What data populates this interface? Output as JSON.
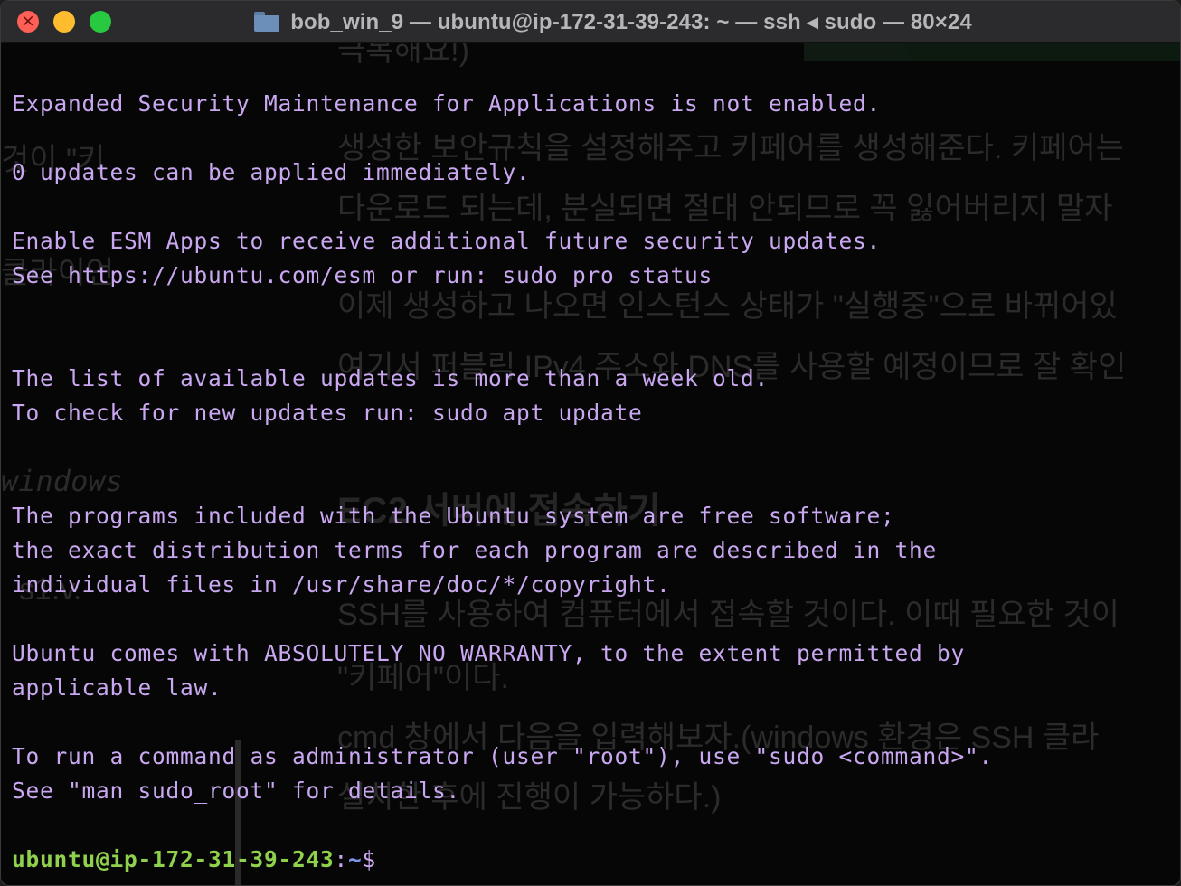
{
  "window": {
    "title": "bob_win_9 — ubuntu@ip-172-31-39-243: ~ — ssh ◂ sudo — 80×24"
  },
  "terminal": {
    "lines": [
      "Expanded Security Maintenance for Applications is not enabled.",
      "",
      "0 updates can be applied immediately.",
      "",
      "Enable ESM Apps to receive additional future security updates.",
      "See https://ubuntu.com/esm or run: sudo pro status",
      "",
      "",
      "The list of available updates is more than a week old.",
      "To check for new updates run: sudo apt update",
      "",
      "",
      "The programs included with the Ubuntu system are free software;",
      "the exact distribution terms for each program are described in the",
      "individual files in /usr/share/doc/*/copyright.",
      "",
      "Ubuntu comes with ABSOLUTELY NO WARRANTY, to the extent permitted by",
      "applicable law.",
      "",
      "To run a command as administrator (user \"root\"), use \"sudo <command>\".",
      "See \"man sudo_root\" for details."
    ],
    "prompt": {
      "user_host": "ubuntu@ip-172-31-39-243",
      "colon": ":",
      "path": "~",
      "symbol": "$ ",
      "cursor": "_"
    }
  },
  "background_text": [
    "극복해요!)",
    "생성한 보안규칙을 설정해주고 키페어를 생성해준다. 키페어는",
    "것이 \"키",
    "다운로드 되는데, 분실되면 절대 안되므로 꼭 잃어버리지 말자",
    "클라이언",
    "이제 생성하고 나오면 인스턴스 상태가 \"실행중\"으로 바뀌어있",
    "여기서 퍼블릭 IPv4 주소와 DNS를 사용할 예정이므로 잘 확인",
    "windows",
    "EC2 서버에 접속하기",
    "s1.v.",
    "SSH를 사용하여 컴퓨터에서 접속할 것이다. 이때 필요한 것이",
    "\"키페어\"이다.",
    "cmd 창에서 다음을 입력해보자.(windows 환경은 SSH 클라",
    "설치한 후에 진행이 가능하다.)"
  ],
  "colors": {
    "text": "#c9a8f1",
    "prompt_user": "#8fd14d",
    "prompt_path": "#7b96e8",
    "background": "#060606"
  }
}
